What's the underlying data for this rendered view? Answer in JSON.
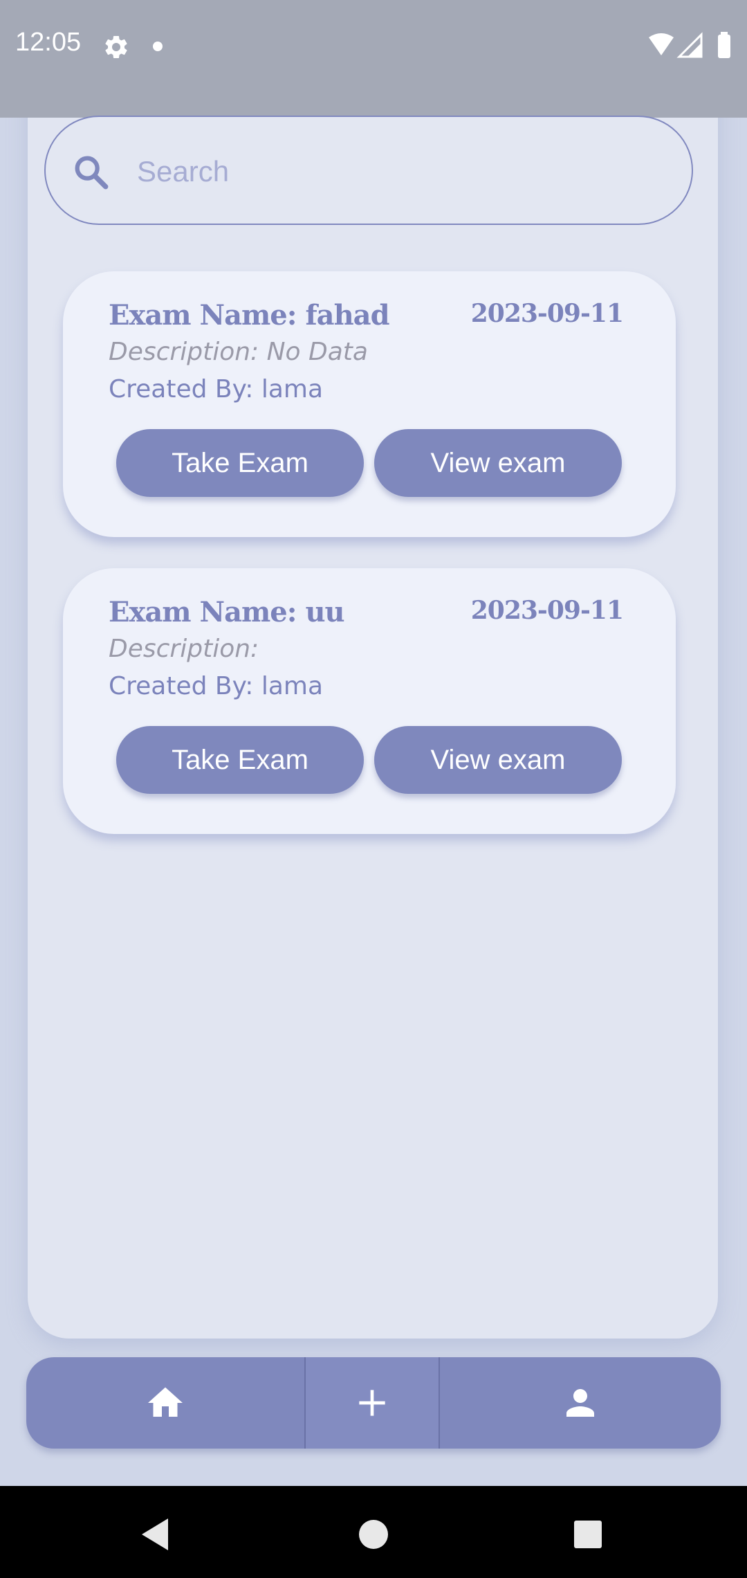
{
  "status_bar": {
    "time": "12:05",
    "icons": [
      "settings-icon",
      "notification-dot",
      "wifi-icon",
      "signal-icon",
      "battery-icon"
    ]
  },
  "search": {
    "placeholder": "Search",
    "value": ""
  },
  "exams": [
    {
      "title": "Exam Name: fahad",
      "date": "2023-09-11",
      "description": "Description: No Data",
      "created_by": "Created By: lama",
      "take_label": "Take Exam",
      "view_label": "View exam"
    },
    {
      "title": "Exam Name: uu",
      "date": "2023-09-11",
      "description": "Description:",
      "created_by": "Created By: lama",
      "take_label": "Take Exam",
      "view_label": "View exam"
    }
  ],
  "bottom_nav": {
    "items": [
      "home-icon",
      "add-icon",
      "person-icon"
    ]
  },
  "colors": {
    "accent": "#7f88bd",
    "card_bg": "#eef1fa",
    "panel_bg": "#e1e5f1",
    "page_bg": "#cfd6e8"
  }
}
